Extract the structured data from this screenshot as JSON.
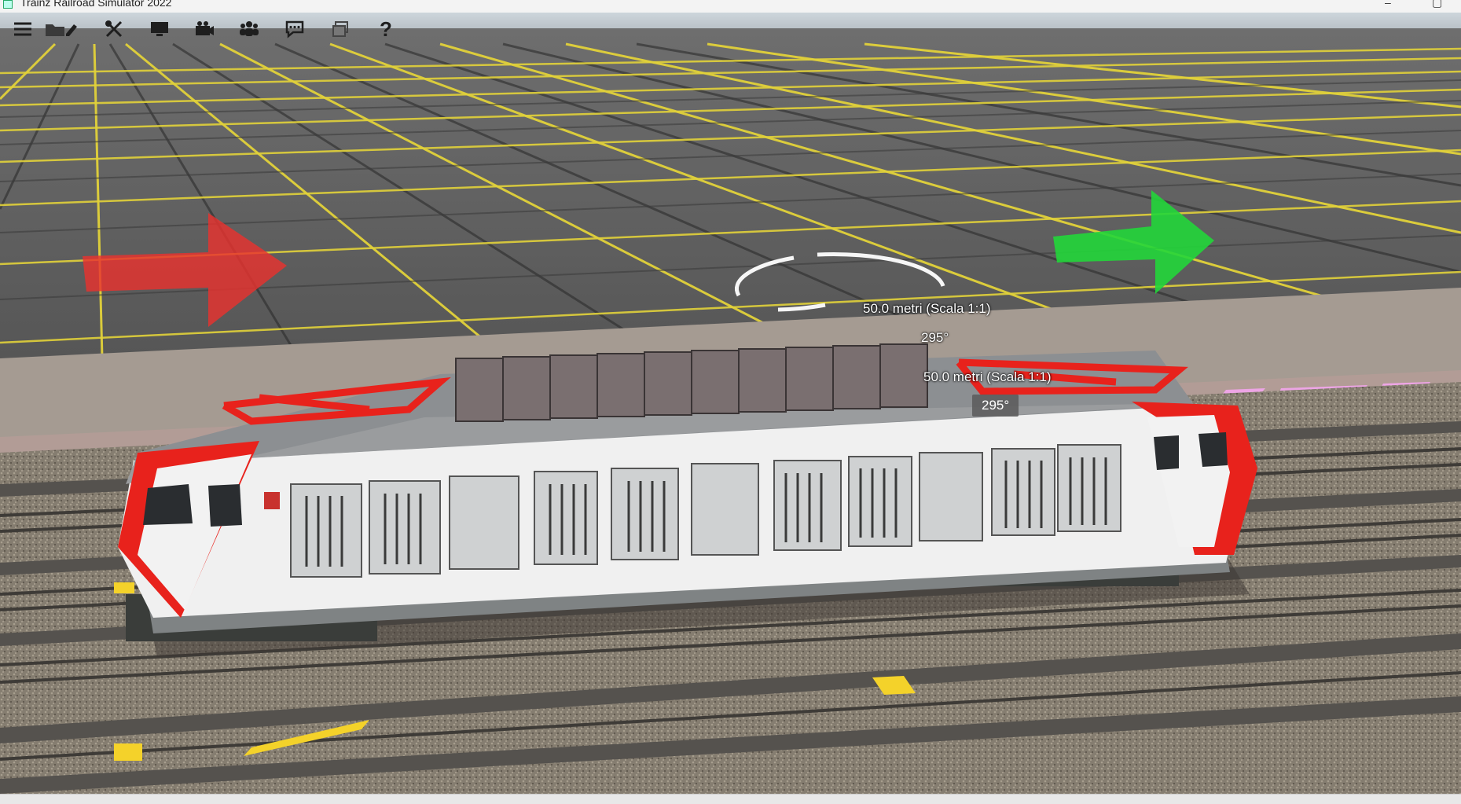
{
  "window": {
    "title": "Trainz Railroad Simulator 2022"
  },
  "toolbar": {
    "items": [
      {
        "icon": "hamburger-menu-icon"
      },
      {
        "icon": "folder-edit-icon"
      },
      {
        "icon": "tools-icon"
      },
      {
        "icon": "monitor-icon"
      },
      {
        "icon": "camera-icon"
      },
      {
        "icon": "people-icon"
      },
      {
        "icon": "chat-icon"
      },
      {
        "icon": "windows-icon"
      },
      {
        "icon": "help-icon"
      }
    ]
  },
  "overlay": {
    "distance_label_1": "50.0 metri (Scala 1:1)",
    "angle_label_1": "295°",
    "distance_label_2": "50.0 metri (Scala 1:1)",
    "angle_badge": "295°"
  },
  "colors": {
    "red_arrow": "#e8322e",
    "green_arrow": "#22d63a",
    "grid_yellow": "#e2d23a",
    "loco_red": "#e8221c",
    "loco_white": "#f2f2f2"
  }
}
